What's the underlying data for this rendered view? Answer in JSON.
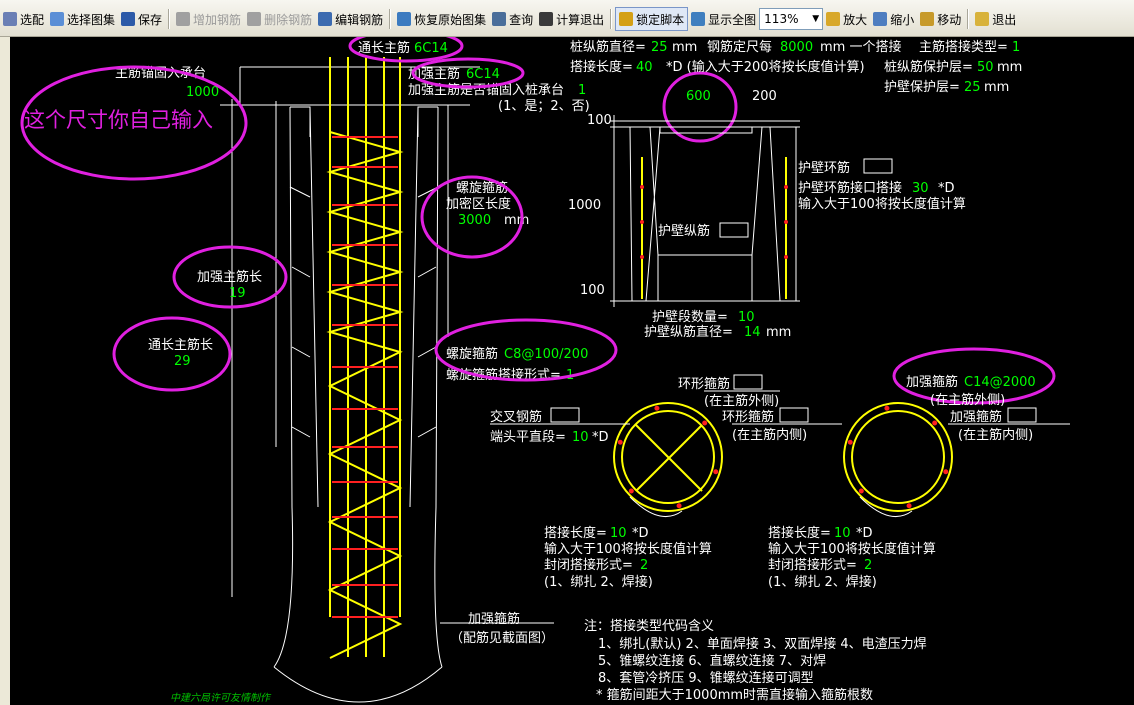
{
  "toolbar": {
    "items": [
      {
        "label": "选配",
        "icon": "paste-icon",
        "color": "#6a7fb5",
        "enabled": true
      },
      {
        "label": "选择图集",
        "icon": "select-atlas-icon",
        "color": "#5b8fd6",
        "enabled": true
      },
      {
        "label": "保存",
        "icon": "save-icon",
        "color": "#2c5aa8",
        "enabled": true
      },
      {
        "label": "增加钢筋",
        "icon": "add-rebar-icon",
        "color": "#a0a0a0",
        "enabled": false
      },
      {
        "label": "删除钢筋",
        "icon": "delete-rebar-icon",
        "color": "#a0a0a0",
        "enabled": false
      },
      {
        "label": "编辑钢筋",
        "icon": "edit-rebar-icon",
        "color": "#3c6bb0",
        "enabled": true
      },
      {
        "label": "恢复原始图集",
        "icon": "restore-icon",
        "color": "#3c7bc0",
        "enabled": true
      },
      {
        "label": "查询",
        "icon": "binoculars-icon",
        "color": "#4a6e9a",
        "enabled": true
      },
      {
        "label": "计算退出",
        "icon": "fx-icon",
        "color": "#3a3a3a",
        "enabled": true
      },
      {
        "label": "锁定脚本",
        "icon": "lock-icon",
        "color": "#d4a017",
        "enabled": true,
        "active": true
      },
      {
        "label": "显示全图",
        "icon": "show-all-icon",
        "color": "#3f7fbf",
        "enabled": true
      },
      {
        "label": "放大",
        "icon": "zoom-in-icon",
        "color": "#d8a82a",
        "enabled": true
      },
      {
        "label": "缩小",
        "icon": "zoom-out-icon",
        "color": "#4d7dc0",
        "enabled": true
      },
      {
        "label": "移动",
        "icon": "move-icon",
        "color": "#c79a2a",
        "enabled": true
      },
      {
        "label": "退出",
        "icon": "exit-icon",
        "color": "#d8b23a",
        "enabled": true
      }
    ],
    "zoom": "113%"
  },
  "colors": {
    "rebar": "#ffff00",
    "stirrup": "#ff2020",
    "line": "#ffffff",
    "value": "#00ff00",
    "highlight": "#e020e0",
    "footer": "#00c000"
  },
  "drawing": {
    "main_bar_label": "通长主筋",
    "main_bar_value": "6C14",
    "strengthen_bar_label": "加强主筋",
    "strengthen_bar_value": "6C14",
    "strengthen_anchor_question": "加强主筋是否锚固入桩承台",
    "strengthen_anchor_value": "1",
    "strengthen_anchor_options": "(1、是；2、否)",
    "anchor_label": "主筋锚固入承台",
    "anchor_value": "1000",
    "handwritten_note": "这个尺寸你自己输入",
    "spiral_label_1": "螺旋箍筋",
    "spiral_label_2": "加密区长度",
    "spiral_dense_value": "3000",
    "spiral_dense_unit": "mm",
    "strengthen_len_label": "加强主筋长",
    "strengthen_len_value": "19",
    "main_len_label": "通长主筋长",
    "main_len_value": "29",
    "spiral_spec_label": "螺旋箍筋",
    "spiral_spec_value": "C8@100/200",
    "spiral_lap_label": "螺旋箍筋搭接形式=",
    "spiral_lap_value": "1",
    "bottom_hoop_label": "加强箍筋",
    "bottom_hoop_note": "（配筋见截面图）",
    "pile_dia_label": "桩纵筋直径=",
    "pile_dia_value": "25",
    "pile_dia_unit": "mm",
    "fixed_len_label": "钢筋定尺每",
    "fixed_len_value": "8000",
    "fixed_len_unit": "mm 一个搭接",
    "lap_type_label": "主筋搭接类型=",
    "lap_type_value": "1",
    "lap_len_label": "搭接长度=",
    "lap_len_value": "40",
    "lap_len_unit": "*D (输入大于200将按长度值计算)",
    "cover_label": "桩纵筋保护层=",
    "cover_value": "50",
    "cover_unit": "mm",
    "wall_cover_label": "护壁保护层=",
    "wall_cover_value": "25",
    "wall_cover_unit": "mm",
    "dim_600": "600",
    "dim_200": "200",
    "dim_100_top": "100",
    "dim_1000": "1000",
    "dim_100_bottom": "100",
    "wall_hoop_label": "护壁环筋",
    "wall_hoop_lap_label": "护壁环筋接口搭接",
    "wall_hoop_lap_value": "30",
    "wall_hoop_lap_unit": "*D",
    "wall_hoop_note": "输入大于100将按长度值计算",
    "wall_long_label": "护壁纵筋",
    "wall_seg_label": "护壁段数量=",
    "wall_seg_value": "10",
    "wall_long_dia_label": "护壁纵筋直径=",
    "wall_long_dia_value": "14",
    "wall_long_dia_unit": "mm",
    "sec1_ring_label": "环形箍筋",
    "sec1_ring_outer": "(在主筋外侧)",
    "sec1_ring2_label": "环形箍筋",
    "sec1_ring_inner": "(在主筋内侧)",
    "cross_label": "交叉钢筋",
    "cross_end_label": "端头平直段=",
    "cross_end_value": "10",
    "cross_end_unit": "*D",
    "sec2_hoop_label": "加强箍筋",
    "sec2_hoop_value": "C14@2000",
    "sec2_outer": "(在主筋外侧)",
    "sec2_hoop2_label": "加强箍筋",
    "sec2_inner": "(在主筋内侧)",
    "sec_lap_label": "搭接长度=",
    "sec_lap_value": "10",
    "sec_lap_unit": "*D",
    "sec_lap_note": "输入大于100将按长度值计算",
    "sec_close_label": "封闭搭接形式=",
    "sec_close_value": "2",
    "sec_close_options": "(1、绑扎  2、焊接)",
    "note_title": "注：搭接类型代码含义",
    "note_line1": "1、绑扎(默认)    2、单面焊接    3、双面焊接    4、电渣压力焊",
    "note_line2": "5、锥螺纹连接    6、直螺纹连接    7、对焊",
    "note_line3": "8、套管冷挤压    9、锥螺纹连接可调型",
    "note_line4": "* 箍筋间距大于1000mm时需直接输入箍筋根数",
    "footer": "中建六局许可友情制作"
  }
}
